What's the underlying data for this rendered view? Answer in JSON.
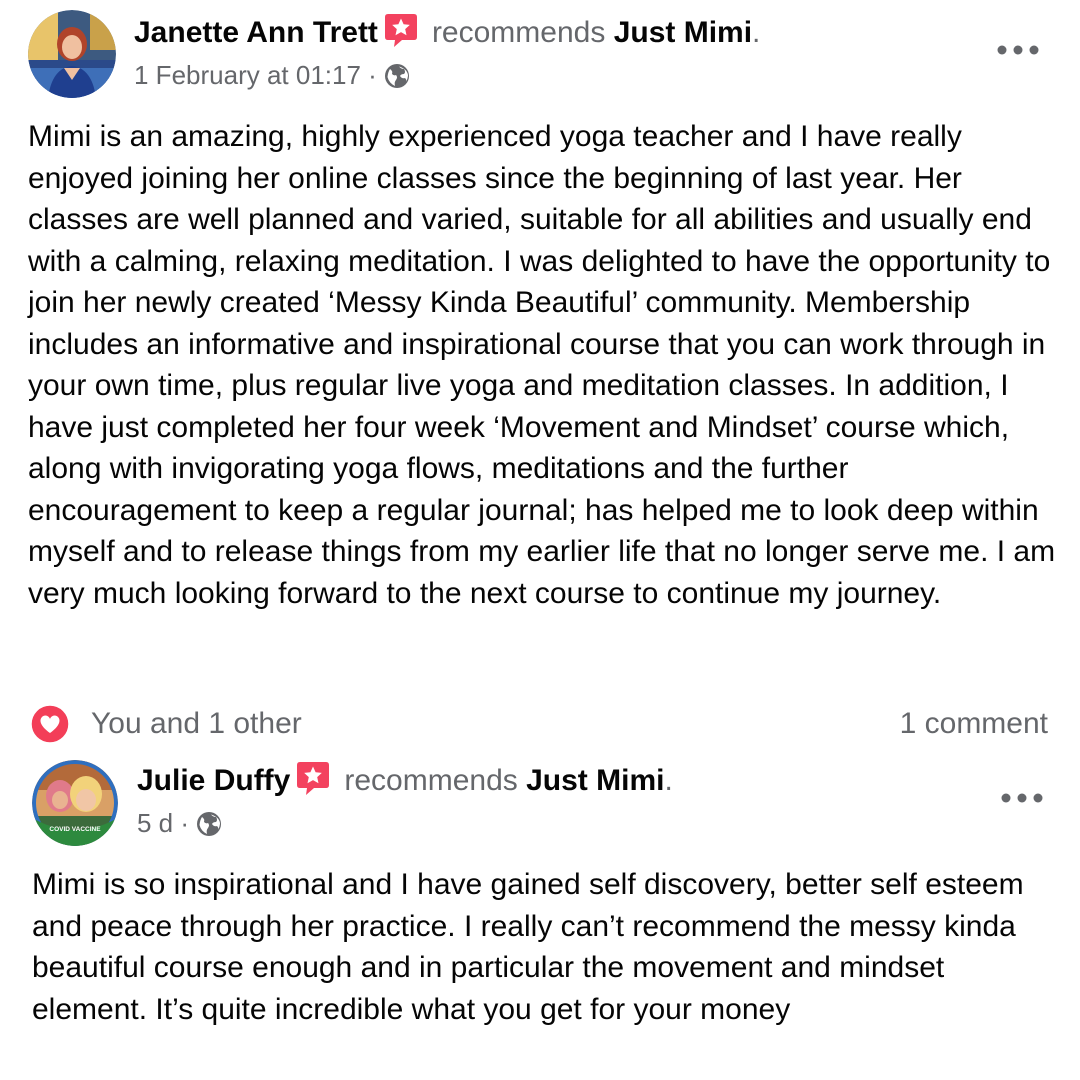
{
  "posts": [
    {
      "author": "Janette Ann Trett",
      "recommends_word": "recommends",
      "page_name": "Just Mimi",
      "period": ".",
      "timestamp": "1 February at 01:17",
      "separator": "·",
      "body": "Mimi is an amazing, highly experienced yoga teacher and I have really enjoyed joining her online classes since the beginning of last year. Her classes are well planned and varied, suitable for all abilities and usually end with a calming, relaxing meditation. I was delighted to have the opportunity to join her newly created ‘Messy Kinda Beautiful’ community. Membership includes an informative and inspirational course that you can work through in your own time, plus regular live yoga and meditation classes. In addition, I have just completed her four week ‘Movement and Mindset’ course which, along with invigorating yoga flows, meditations and the further encouragement to keep a regular journal; has helped me to look deep within myself and to release things from my earlier life that no longer serve me. I am very much looking forward to the next course to continue my journey.",
      "reactions_text": "You and 1 other",
      "comments_text": "1 comment",
      "icons": {
        "badge": "recommendation-star-icon",
        "privacy": "globe-icon",
        "menu": "more-options-icon",
        "reaction": "love-reaction-icon"
      }
    },
    {
      "author": "Julie Duffy",
      "recommends_word": "recommends",
      "page_name": "Just Mimi",
      "period": ".",
      "timestamp": "5 d",
      "separator": "·",
      "body": "Mimi is so inspirational and I have gained self discovery, better self esteem and peace through her practice. I really can’t recommend the messy kinda beautiful course enough and in particular the movement and mindset element. It’s quite incredible what you get for your money",
      "avatar_frame_text": "COVID VACCINE",
      "icons": {
        "badge": "recommendation-star-icon",
        "privacy": "globe-icon",
        "menu": "more-options-icon"
      }
    }
  ],
  "colors": {
    "primary_text": "#050505",
    "secondary_text": "#65676b",
    "recommend_badge": "#f3425f",
    "love_reaction": "#f33e58"
  }
}
